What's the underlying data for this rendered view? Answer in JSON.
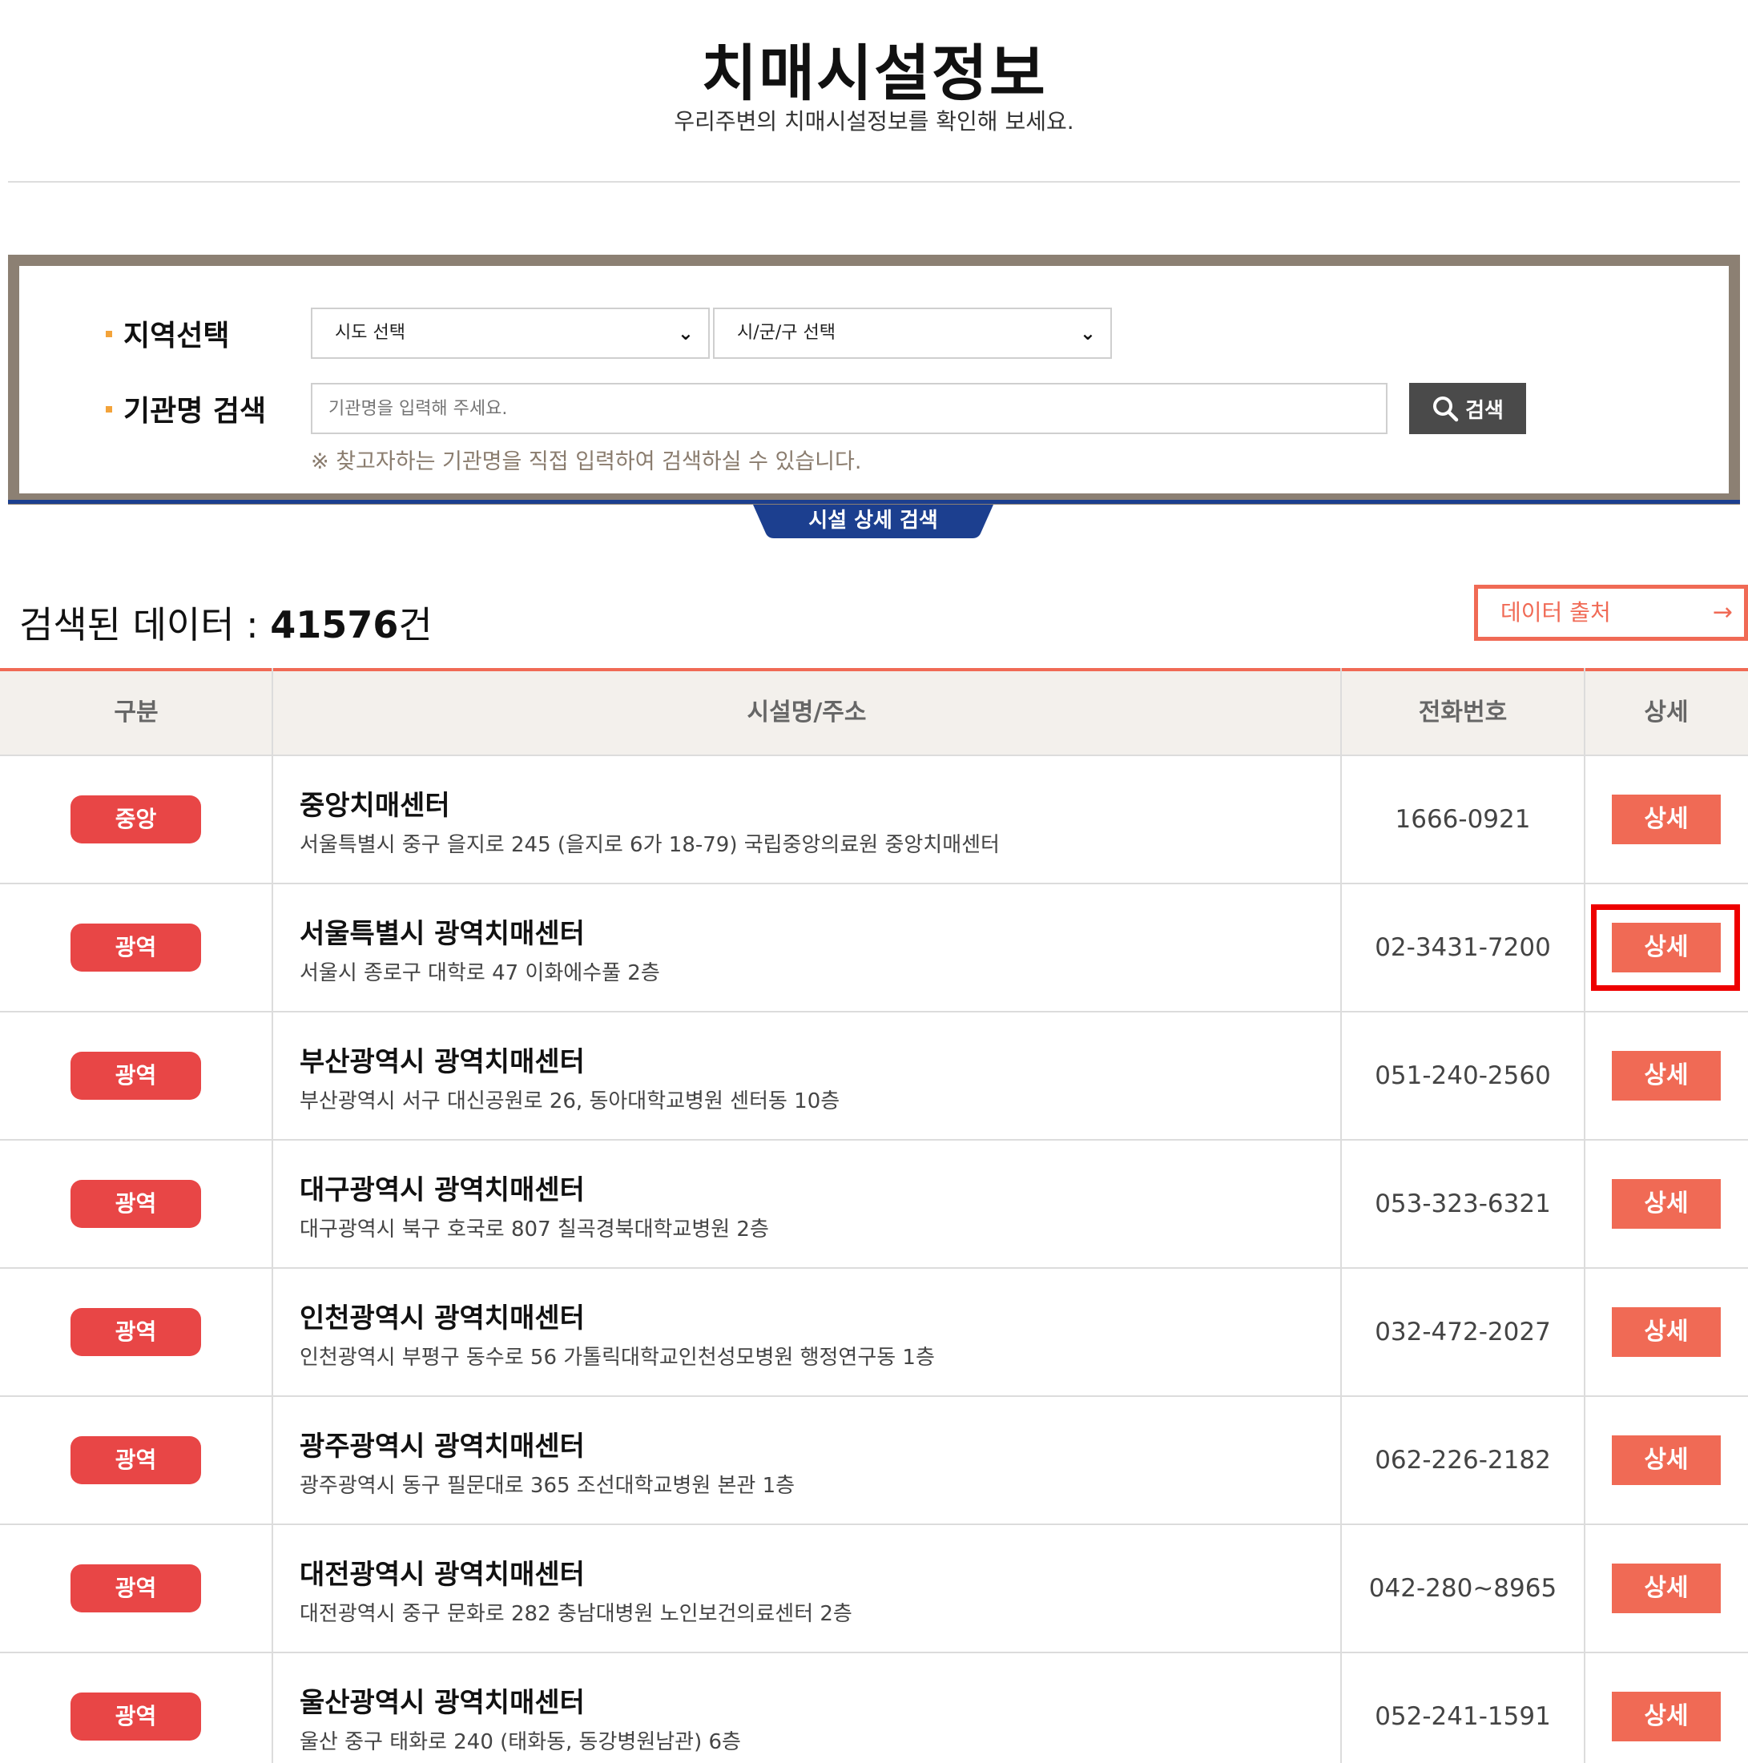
{
  "header": {
    "title": "치매시설정보",
    "subtitle": "우리주변의 치매시설정보를 확인해 보세요."
  },
  "search": {
    "region_label": "지역선택",
    "name_label": "기관명 검색",
    "sido_select": "시도 선택",
    "sigungu_select": "시/군/구 선택",
    "name_placeholder": "기관명을 입력해 주세요.",
    "search_button": "검색",
    "hint": "※ 찾고자하는 기관명을 직접 입력하여 검색하실 수 있습니다.",
    "detail_tab": "시설 상세 검색"
  },
  "results": {
    "count_prefix": "검색된 데이터 : ",
    "count_value": "41576",
    "count_suffix": "건",
    "source_button": "데이터 출처",
    "source_arrow": "→"
  },
  "table": {
    "columns": [
      "구분",
      "시설명/주소",
      "전화번호",
      "상세"
    ],
    "rows": [
      {
        "type": "중앙",
        "name": "중앙치매센터",
        "address": "서울특별시 중구 을지로 245 (을지로 6가 18-79) 국립중앙의료원 중앙치매센터",
        "phone": "1666-0921",
        "detail": "상세"
      },
      {
        "type": "광역",
        "name": "서울특별시 광역치매센터",
        "address": "서울시 종로구 대학로 47 이화에수풀 2층",
        "phone": "02-3431-7200",
        "detail": "상세"
      },
      {
        "type": "광역",
        "name": "부산광역시 광역치매센터",
        "address": "부산광역시 서구 대신공원로 26, 동아대학교병원 센터동 10층",
        "phone": "051-240-2560",
        "detail": "상세"
      },
      {
        "type": "광역",
        "name": "대구광역시 광역치매센터",
        "address": "대구광역시 북구 호국로 807 칠곡경북대학교병원 2층",
        "phone": "053-323-6321",
        "detail": "상세"
      },
      {
        "type": "광역",
        "name": "인천광역시 광역치매센터",
        "address": "인천광역시 부평구 동수로 56 가톨릭대학교인천성모병원 행정연구동 1층",
        "phone": "032-472-2027",
        "detail": "상세"
      },
      {
        "type": "광역",
        "name": "광주광역시 광역치매센터",
        "address": "광주광역시 동구 필문대로 365 조선대학교병원 본관 1층",
        "phone": "062-226-2182",
        "detail": "상세"
      },
      {
        "type": "광역",
        "name": "대전광역시 광역치매센터",
        "address": "대전광역시 중구 문화로 282 충남대병원 노인보건의료센터 2층",
        "phone": "042-280~8965",
        "detail": "상세"
      },
      {
        "type": "광역",
        "name": "울산광역시 광역치매센터",
        "address": "울산 중구 태화로 240 (태화동, 동강병원남관) 6층",
        "phone": "052-241-1591",
        "detail": "상세"
      }
    ]
  },
  "colors": {
    "accent": "#f06a55",
    "badge": "#e84646",
    "frame": "#8c8073",
    "navy": "#1c3f8f",
    "highlight": "#ee0000"
  }
}
